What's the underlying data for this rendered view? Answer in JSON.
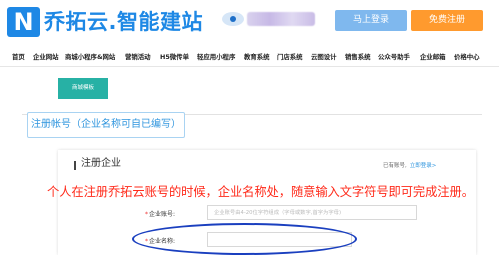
{
  "header": {
    "logo_letter": "N",
    "logo_text": "乔拓云.智能建站",
    "login_label": "马上登录",
    "register_label": "免费注册"
  },
  "nav": {
    "items": [
      "首页",
      "企业网站",
      "商城小程序&网站",
      "营销活动",
      "H5微传单",
      "轻应用小程序",
      "教育系统",
      "门店系统",
      "云图设计",
      "销售系统",
      "公众号助手",
      "企业邮箱",
      "价格中心"
    ]
  },
  "dropdown": {
    "label": "商城模板"
  },
  "tab": {
    "label": "注册帐号（企业名称可自已编写）"
  },
  "form": {
    "title": "注册企业",
    "have_account": "已有账号,",
    "login_link": "立即登录>",
    "notice": "个人在注册乔拓云账号的时候，企业名称处，随意输入文字符号即可完成注册。",
    "fields": [
      {
        "label": "企业账号:",
        "placeholder": "企业账号由4-20位字符组成（字母或数字,首字为字母)"
      },
      {
        "label": "企业名称:",
        "placeholder": ""
      }
    ]
  },
  "colors": {
    "brand_blue": "#1e88e5",
    "login_btn": "#7fb8ee",
    "register_btn": "#ff9a2e",
    "notice_red": "#ff2a1a",
    "annotation_ellipse": "#1a3fbf"
  }
}
